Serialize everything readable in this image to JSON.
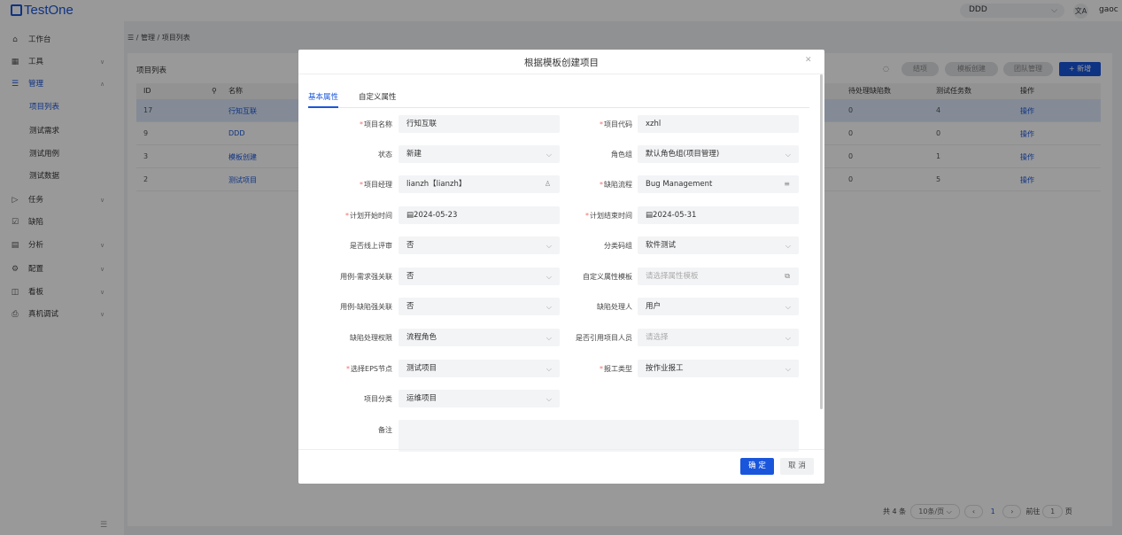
{
  "app": {
    "logo_text": "TestOne",
    "project_select": "DDD",
    "translate_icon": "translate-icon",
    "username": "gaoc"
  },
  "sidebar": {
    "items": [
      {
        "label": "工作台",
        "icon": "home-icon"
      },
      {
        "label": "工具",
        "icon": "grid-icon"
      },
      {
        "label": "管理",
        "icon": "list-icon"
      },
      {
        "label": "项目列表"
      },
      {
        "label": "测试需求"
      },
      {
        "label": "测试用例"
      },
      {
        "label": "测试数据"
      },
      {
        "label": "任务",
        "icon": "play-icon"
      },
      {
        "label": "缺陷",
        "icon": "check-square-icon"
      },
      {
        "label": "分析",
        "icon": "calendar-icon"
      },
      {
        "label": "配置",
        "icon": "gear-icon"
      },
      {
        "label": "看板",
        "icon": "board-icon"
      },
      {
        "label": "真机调试",
        "icon": "device-icon"
      }
    ]
  },
  "breadcrumb": {
    "text": "☰ / 管理 / 项目列表"
  },
  "panel": {
    "title": "项目列表",
    "toolbar": {
      "close": "结项",
      "template_create": "模板创建",
      "team": "团队管理",
      "new": "+ 新增"
    },
    "columns": [
      "ID",
      "名称",
      "待处理缺陷数",
      "测试任务数",
      "操作"
    ],
    "rows": [
      {
        "id": "17",
        "name": "行知互联",
        "bugs": "0",
        "tasks": "4",
        "op": "操作"
      },
      {
        "id": "9",
        "name": "DDD",
        "bugs": "0",
        "tasks": "0",
        "op": "操作"
      },
      {
        "id": "3",
        "name": "模板创建",
        "bugs": "0",
        "tasks": "1",
        "op": "操作"
      },
      {
        "id": "2",
        "name": "测试项目",
        "bugs": "0",
        "tasks": "5",
        "op": "操作"
      }
    ]
  },
  "pager": {
    "total": "共 4 条",
    "page_size": "10条/页",
    "current": "1",
    "goto_label": "前往",
    "goto_value": "1",
    "page_unit": "页"
  },
  "modal": {
    "title": "根据模板创建项目",
    "tabs": [
      "基本属性",
      "自定义属性"
    ],
    "fields": {
      "project_name": {
        "label": "项目名称",
        "value": "行知互联"
      },
      "project_code": {
        "label": "项目代码",
        "value": "xzhl"
      },
      "status": {
        "label": "状态",
        "value": "新建"
      },
      "role_group": {
        "label": "角色组",
        "value": "默认角色组(项目管理)"
      },
      "manager": {
        "label": "项目经理",
        "value": "lianzh【lianzh】"
      },
      "bug_flow": {
        "label": "缺陷流程",
        "value": "Bug Management"
      },
      "plan_start": {
        "label": "计划开始时间",
        "value": "2024-05-23"
      },
      "plan_end": {
        "label": "计划结束时间",
        "value": "2024-05-31"
      },
      "online_review": {
        "label": "是否线上评审",
        "value": "否"
      },
      "category_code": {
        "label": "分类码组",
        "value": "软件测试"
      },
      "case_req_link": {
        "label": "用例-需求强关联",
        "value": "否"
      },
      "custom_tpl": {
        "label": "自定义属性模板",
        "placeholder": "请选择属性模板"
      },
      "case_bug_link": {
        "label": "用例-缺陷强关联",
        "value": "否"
      },
      "bug_handler": {
        "label": "缺陷处理人",
        "value": "用户"
      },
      "bug_perm": {
        "label": "缺陷处理权限",
        "value": "流程角色"
      },
      "ref_members": {
        "label": "是否引用项目人员",
        "placeholder": "请选择"
      },
      "eps_node": {
        "label": "选择EPS节点",
        "value": "测试项目"
      },
      "report_type": {
        "label": "报工类型",
        "value": "按作业报工"
      },
      "project_category": {
        "label": "项目分类",
        "value": "运维项目"
      },
      "remark": {
        "label": "备注"
      }
    },
    "ok": "确 定",
    "cancel": "取 消"
  },
  "colors": {
    "primary": "#1a56db",
    "required": "#f56c6c",
    "selected_row": "#dce8fb"
  }
}
